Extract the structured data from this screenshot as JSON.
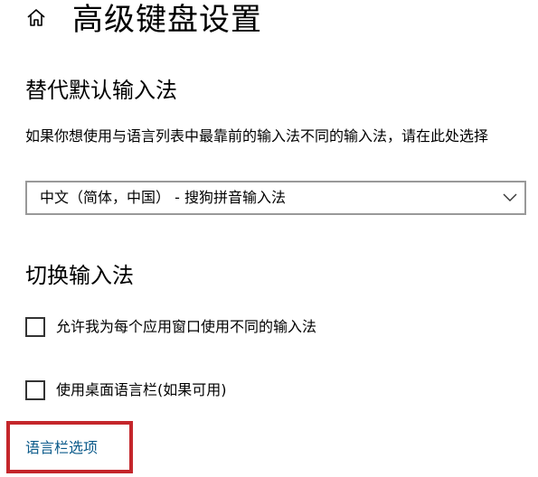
{
  "header": {
    "title": "高级键盘设置",
    "home_icon": "home-icon"
  },
  "default_input": {
    "section_title": "替代默认输入法",
    "description": "如果你想使用与语言列表中最靠前的输入法不同的输入法，请在此处选择",
    "selected_value": "中文（简体，中国） - 搜狗拼音输入法"
  },
  "switch_input": {
    "section_title": "切换输入法",
    "options": [
      {
        "label": "允许我为每个应用窗口使用不同的输入法",
        "checked": false
      },
      {
        "label": "使用桌面语言栏(如果可用)",
        "checked": false
      }
    ]
  },
  "language_bar_link": "语言栏选项",
  "colors": {
    "link": "#0b5a8a",
    "highlight": "#c4262b"
  }
}
